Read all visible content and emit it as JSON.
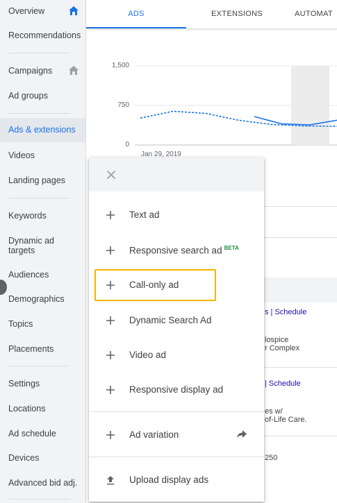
{
  "sidebar": {
    "items": [
      {
        "label": "Overview",
        "top": 9
      },
      {
        "label": "Recommendations",
        "top": 44
      },
      {
        "label": "Campaigns",
        "top": 95
      },
      {
        "label": "Ad groups",
        "top": 131
      },
      {
        "label": "Ads & extensions",
        "top": 181
      },
      {
        "label": "Videos",
        "top": 217
      },
      {
        "label": "Landing pages",
        "top": 253
      },
      {
        "label": "Keywords",
        "top": 304
      },
      {
        "label": "Dynamic ad targets",
        "top": 340
      },
      {
        "label": "Audiences",
        "top": 389
      },
      {
        "label": "Demographics",
        "top": 424
      },
      {
        "label": "Topics",
        "top": 460
      },
      {
        "label": "Placements",
        "top": 496
      },
      {
        "label": "Settings",
        "top": 546
      },
      {
        "label": "Locations",
        "top": 582
      },
      {
        "label": "Ad schedule",
        "top": 618
      },
      {
        "label": "Devices",
        "top": 653
      },
      {
        "label": "Advanced bid adj.",
        "top": 689
      }
    ]
  },
  "tabs": [
    "ADS",
    "EXTENSIONS",
    "AUTOMAT"
  ],
  "chart_data": {
    "type": "line",
    "yticks": [
      "1,500",
      "750",
      "0"
    ],
    "xticks": [
      "Jan 29, 2019"
    ],
    "ylim": [
      0,
      1500
    ],
    "series": [
      {
        "style": "dashed",
        "values": [
          510,
          640,
          600,
          470,
          390,
          360,
          355
        ]
      },
      {
        "style": "solid",
        "values": [
          540,
          400,
          380,
          470
        ]
      }
    ]
  },
  "background": {
    "schedule1": "s | Schedule",
    "line1a": "lospice",
    "line1b": "r Complex",
    "schedule2": "| Schedule",
    "line2a": "es w/",
    "line2b": "of-Life Care.",
    "num": "250"
  },
  "menu": {
    "items": [
      {
        "label": "Text ad",
        "beta": ""
      },
      {
        "label": "Responsive search ad",
        "beta": "BETA"
      },
      {
        "label": "Call-only ad",
        "beta": ""
      },
      {
        "label": "Dynamic Search Ad",
        "beta": ""
      },
      {
        "label": "Video ad",
        "beta": ""
      },
      {
        "label": "Responsive display ad",
        "beta": ""
      },
      {
        "label": "Ad variation",
        "beta": ""
      },
      {
        "label": "Upload display ads",
        "beta": ""
      }
    ]
  },
  "colors": {
    "accent": "#1a73e8",
    "highlight": "#f4b400",
    "beta": "#1e8e3e"
  }
}
